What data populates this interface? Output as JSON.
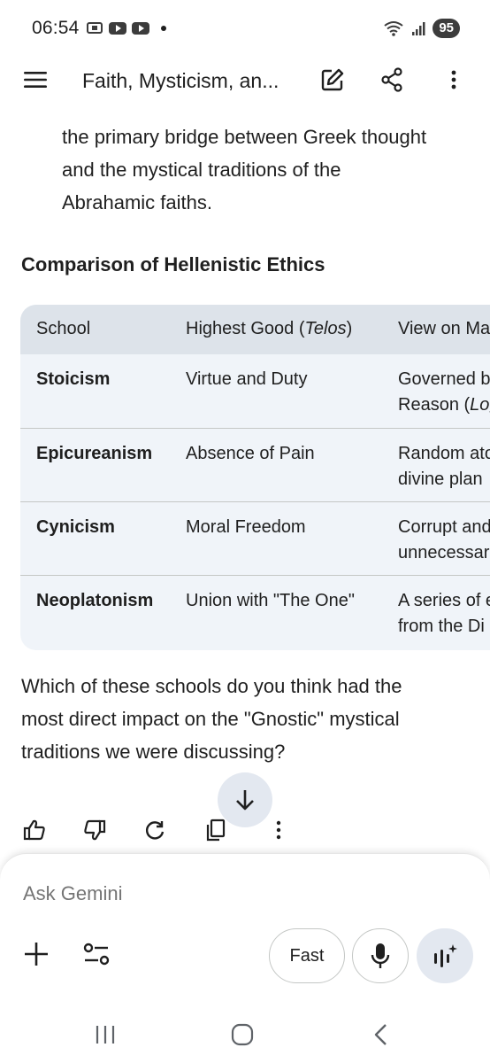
{
  "status_bar": {
    "time": "06:54",
    "notification_icons": [
      "screenshot-icon",
      "youtube-icon",
      "youtube-icon"
    ],
    "battery": "95"
  },
  "app_bar": {
    "title": "Faith, Mysticism, an...",
    "icons": [
      "menu-icon",
      "edit-icon",
      "share-icon",
      "more-vert-icon"
    ]
  },
  "content": {
    "intro_lines": [
      "the primary bridge between Greek thought",
      "and the mystical traditions of the",
      "Abrahamic faiths."
    ],
    "section_heading": "Comparison of Hellenistic Ethics",
    "table": {
      "headers": {
        "school": "School",
        "highest_good_prefix": "Highest Good (",
        "highest_good_italic": "Telos",
        "highest_good_suffix": ")",
        "view": "View on Ma"
      },
      "rows": [
        {
          "school": "Stoicism",
          "highest_good": "Virtue and Duty",
          "view_line1": "Governed b",
          "view_line2_prefix": "Reason (",
          "view_line2_italic": "Log"
        },
        {
          "school": "Epicureanism",
          "highest_good": "Absence of Pain",
          "view_line1": "Random ato",
          "view_line2_prefix": "divine plan",
          "view_line2_italic": ""
        },
        {
          "school": "Cynicism",
          "highest_good": "Moral Freedom",
          "view_line1": "Corrupt and",
          "view_line2_prefix": "unnecessar",
          "view_line2_italic": ""
        },
        {
          "school": "Neoplatonism",
          "highest_good": "Union with \"The One\"",
          "view_line1": "A series of e",
          "view_line2_prefix": "from the Di",
          "view_line2_italic": ""
        }
      ]
    },
    "question_lines": [
      "Which of these schools do you think had the",
      "most direct impact on the \"Gnostic\" mystical",
      "traditions we were discussing?"
    ]
  },
  "response_actions": [
    "thumbs-up-icon",
    "thumbs-down-icon",
    "regenerate-icon",
    "copy-icon",
    "more-vert-icon"
  ],
  "input_panel": {
    "placeholder": "Ask Gemini",
    "mode_button": "Fast"
  },
  "colors": {
    "table_bg": "#f0f4f9",
    "table_header_bg": "#dde3ea",
    "accent_button_bg": "#e3e8f0",
    "text": "#1f1f1f"
  }
}
